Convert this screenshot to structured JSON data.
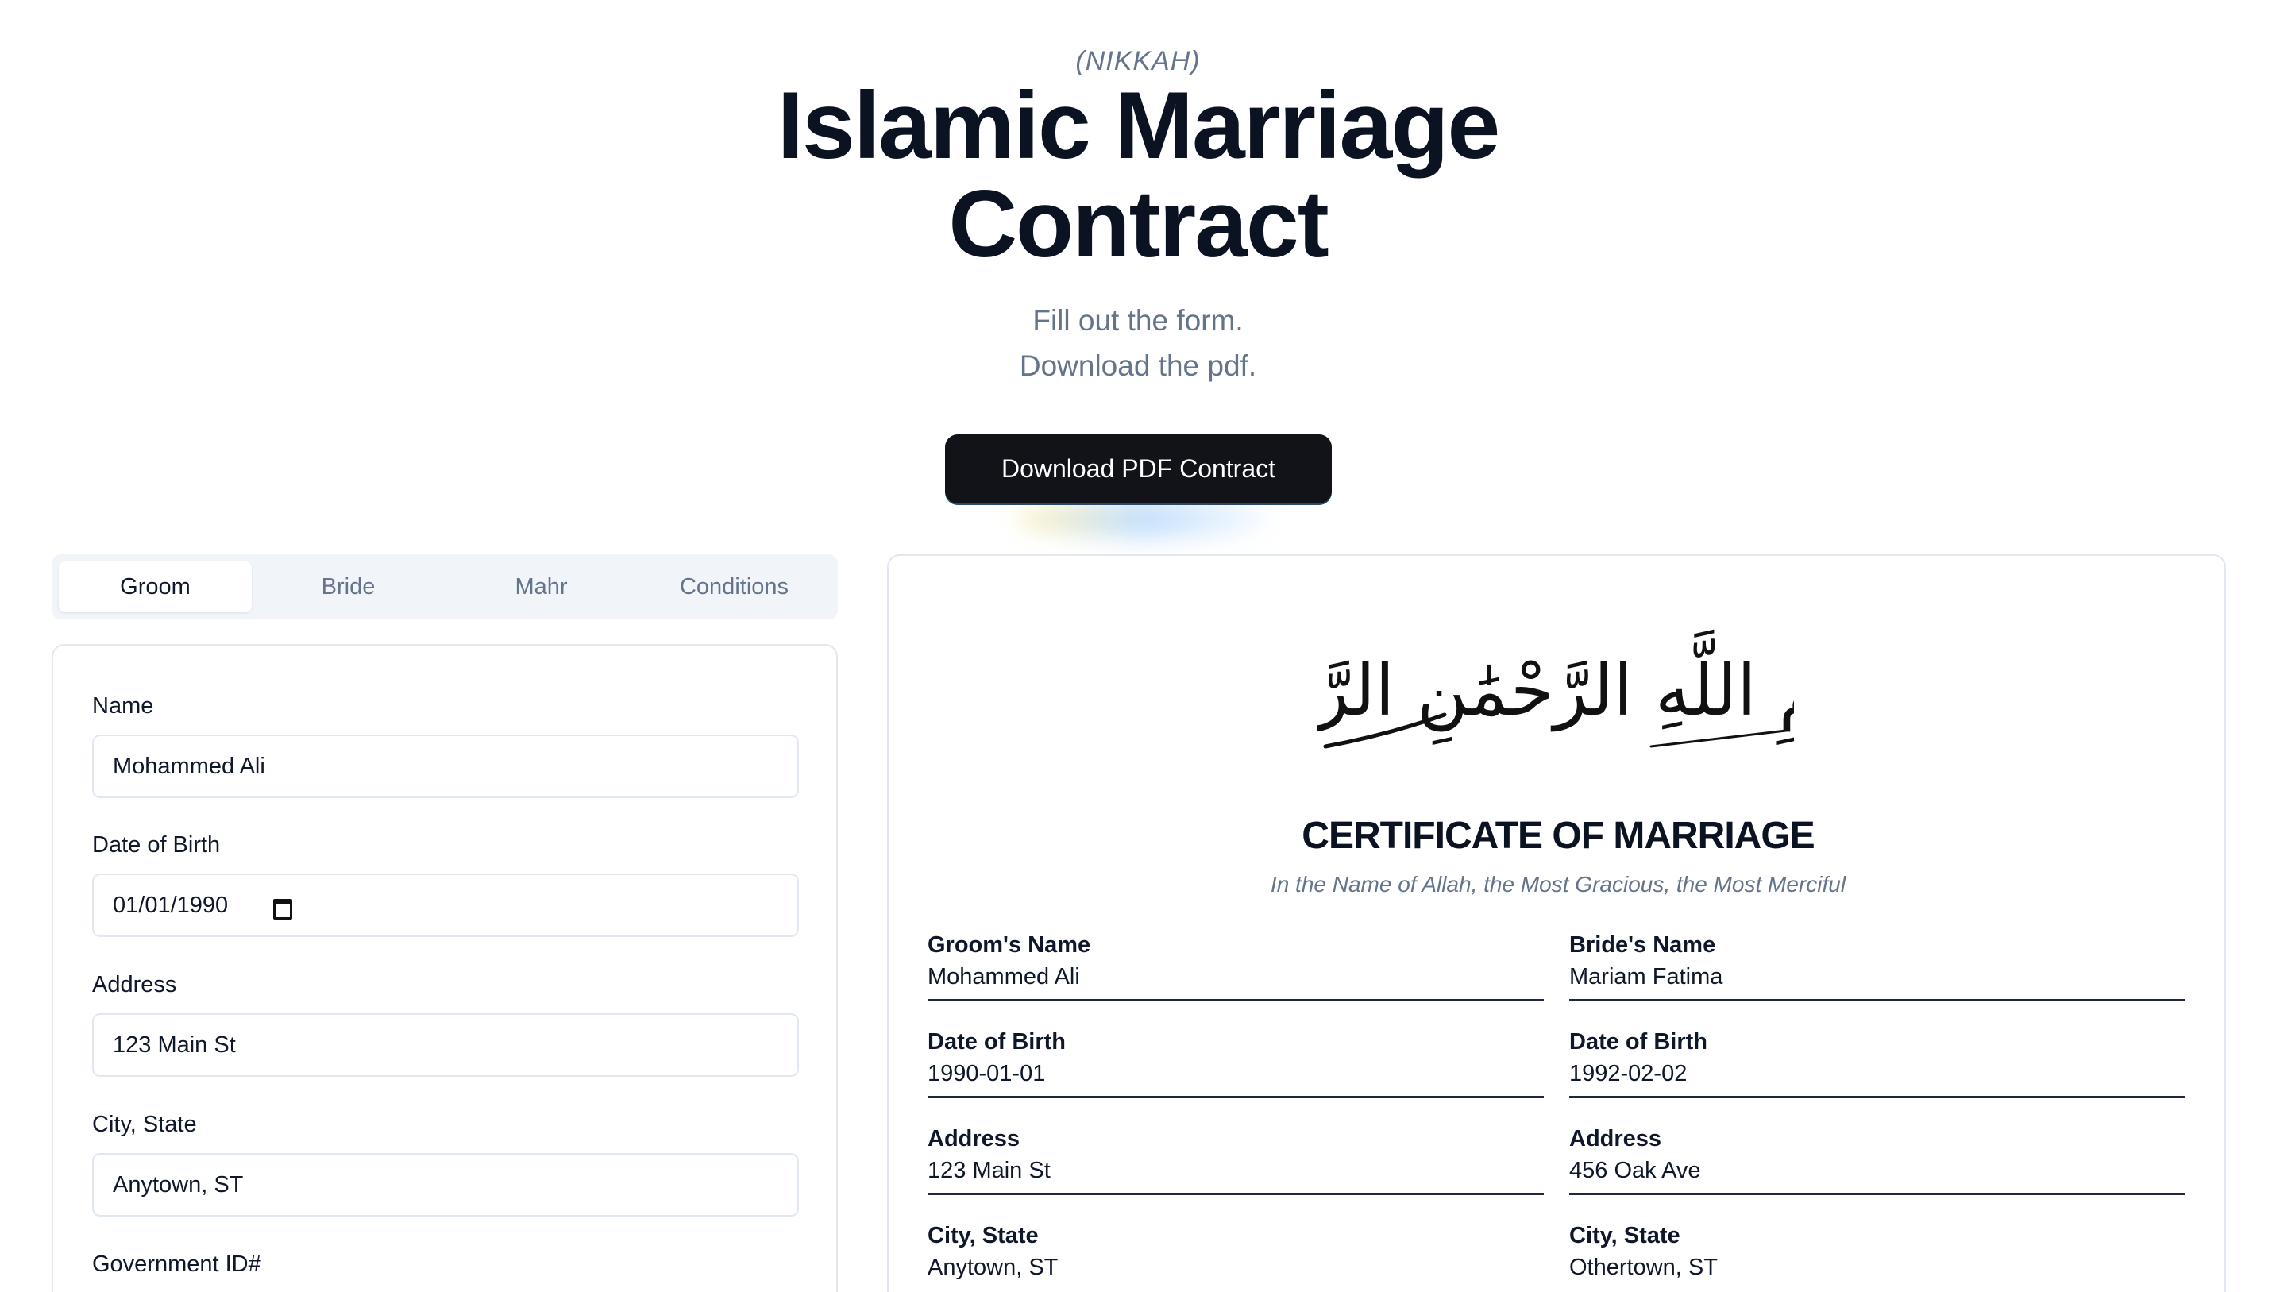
{
  "header": {
    "nikkah": "(NIKKAH)",
    "title_line1": "Islamic Marriage",
    "title_line2": "Contract",
    "subtitle_line1": "Fill out the form.",
    "subtitle_line2": "Download the pdf.",
    "download_label": "Download PDF Contract"
  },
  "tabs": [
    {
      "label": "Groom",
      "active": true
    },
    {
      "label": "Bride",
      "active": false
    },
    {
      "label": "Mahr",
      "active": false
    },
    {
      "label": "Conditions",
      "active": false
    }
  ],
  "form": {
    "name_label": "Name",
    "name_value": "Mohammed Ali",
    "dob_label": "Date of Birth",
    "dob_value": "01/01/1990",
    "address_label": "Address",
    "address_value": "123 Main St",
    "city_label": "City, State",
    "city_value": "Anytown, ST",
    "govid_label": "Government ID#"
  },
  "certificate": {
    "bismillah": "بِسْمِ اللَّهِ الرَّحْمَٰنِ الرَّحِيمِ",
    "title": "CERTIFICATE OF MARRIAGE",
    "subtitle": "In the Name of Allah, the Most Gracious, the Most Merciful",
    "groom": {
      "name_label": "Groom's Name",
      "name": "Mohammed Ali",
      "dob_label": "Date of Birth",
      "dob": "1990-01-01",
      "address_label": "Address",
      "address": "123 Main St",
      "city_label": "City, State",
      "city": "Anytown, ST"
    },
    "bride": {
      "name_label": "Bride's Name",
      "name": "Mariam Fatima",
      "dob_label": "Date of Birth",
      "dob": "1992-02-02",
      "address_label": "Address",
      "address": "456 Oak Ave",
      "city_label": "City, State",
      "city": "Othertown, ST"
    }
  },
  "colors": {
    "primary_button": "#111318",
    "muted_text": "#64748b",
    "border": "#e2e8f0",
    "tab_bg": "#f1f5f9"
  }
}
